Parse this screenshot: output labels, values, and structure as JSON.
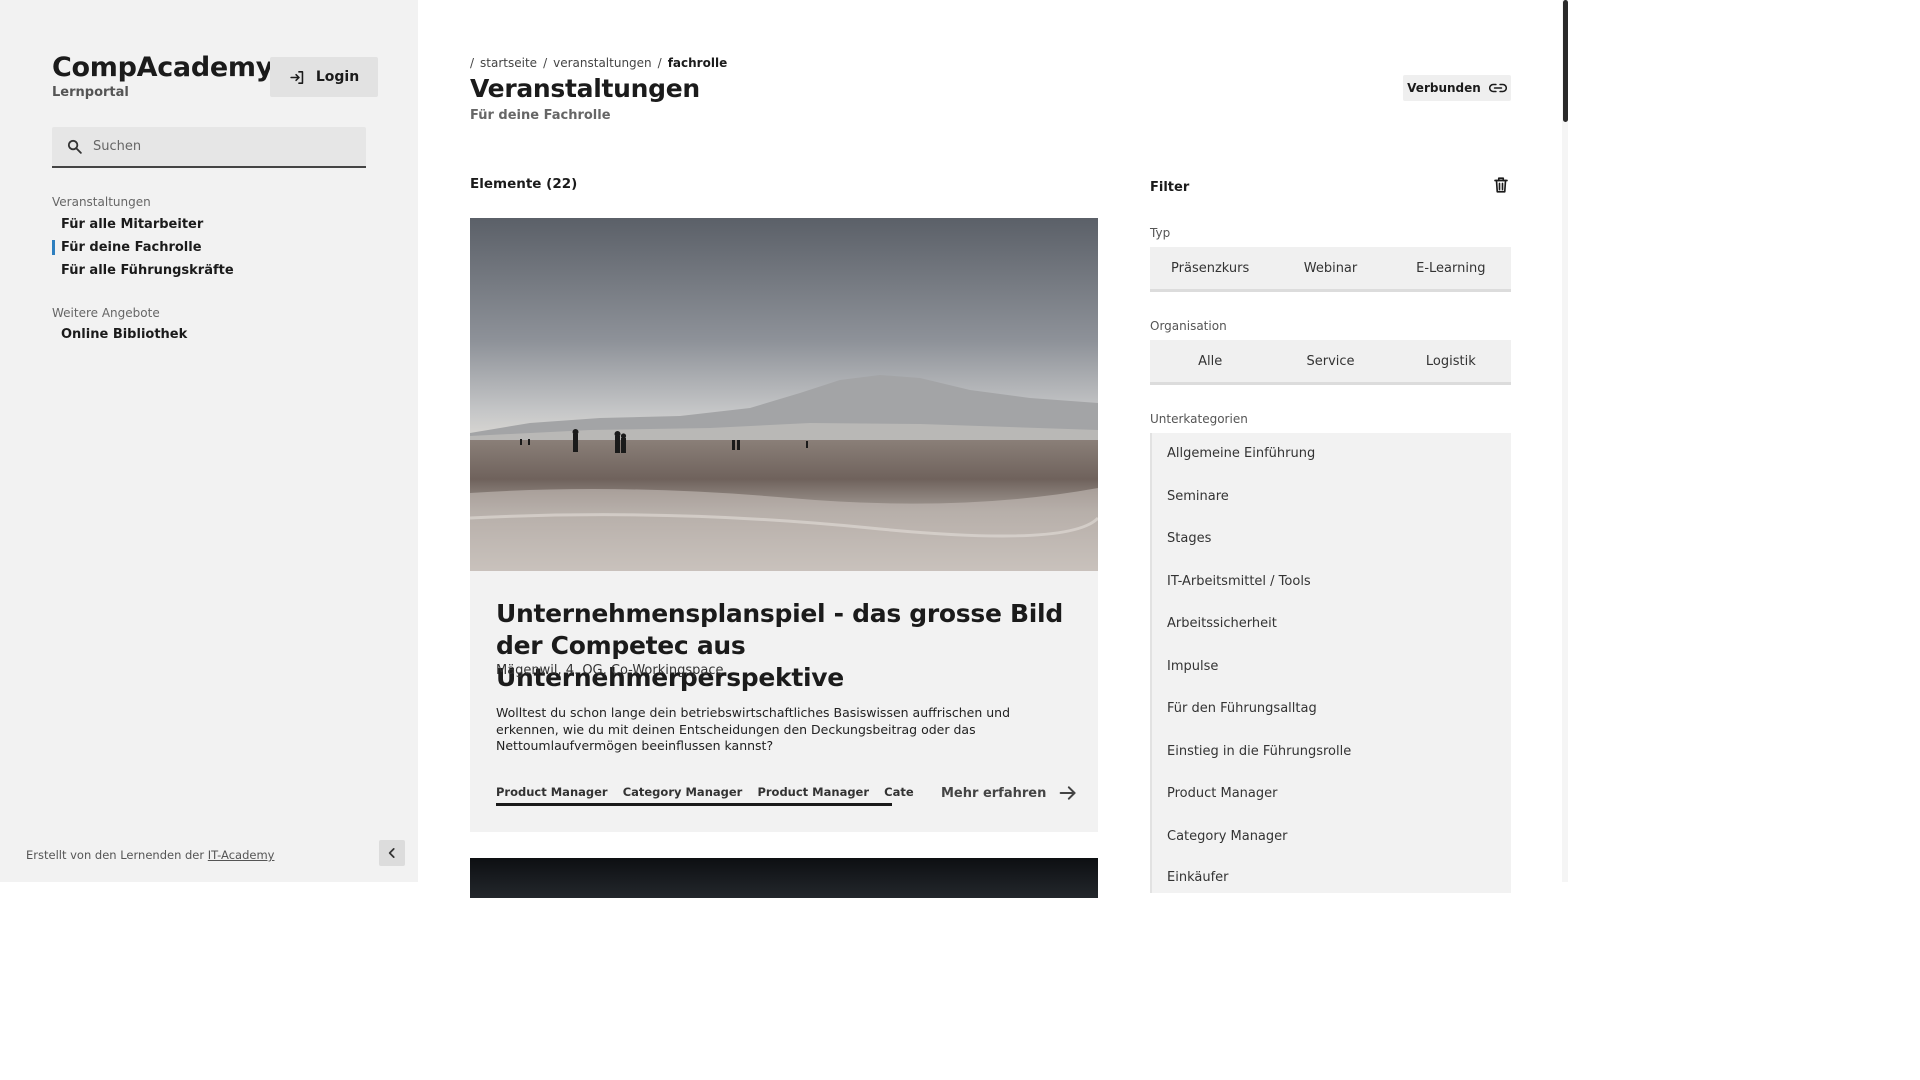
{
  "brand": {
    "title": "CompAcademy",
    "subtitle": "Lernportal"
  },
  "login": {
    "label": "Login"
  },
  "search": {
    "placeholder": "Suchen"
  },
  "nav": {
    "groups": [
      {
        "label": "Veranstaltungen",
        "items": [
          {
            "label": "Für alle Mitarbeiter"
          },
          {
            "label": "Für deine Fachrolle",
            "active": true
          },
          {
            "label": "Für alle Führungskräfte"
          }
        ]
      },
      {
        "label": "Weitere Angebote",
        "items": [
          {
            "label": "Online Bibliothek"
          }
        ]
      }
    ]
  },
  "footer": {
    "prefix": "Erstellt von den Lernenden der",
    "link": "IT-Academy"
  },
  "breadcrumb": {
    "items": [
      "startseite",
      "veranstaltungen",
      "fachrolle"
    ]
  },
  "page": {
    "title": "Veranstaltungen",
    "subtitle": "Für deine Fachrolle"
  },
  "connect": {
    "label": "Verbunden"
  },
  "elements": {
    "label": "Elemente (22)"
  },
  "card": {
    "title": "Unternehmensplanspiel - das grosse Bild der Competec aus Unternehmerperspektive",
    "location": "Mägenwil, 4. OG, Co-Workingspace",
    "description": "Wolltest du schon lange dein betriebswirtschaftliches Basiswissen auffrischen und erkennen, wie du mit deinen Entscheidungen den Deckungsbeitrag oder das Nettoumlaufvermögen beeinflussen kannst?",
    "tags": [
      "Product Manager",
      "Category Manager",
      "Product Manager",
      "Category Manager"
    ],
    "more": "Mehr erfahren"
  },
  "filter": {
    "title": "Filter",
    "typ": {
      "label": "Typ",
      "options": [
        "Präsenzkurs",
        "Webinar",
        "E-Learning"
      ]
    },
    "organisation": {
      "label": "Organisation",
      "options": [
        "Alle",
        "Service",
        "Logistik"
      ]
    },
    "unterkategorien": {
      "label": "Unterkategorien",
      "items": [
        "Allgemeine Einführung",
        "Seminare",
        "Stages",
        "IT-Arbeitsmittel / Tools",
        "Arbeitssicherheit",
        "Impulse",
        "Für den Führungsalltag",
        "Einstieg in die Führungsrolle",
        "Product Manager",
        "Category Manager",
        "Einkäufer"
      ]
    }
  },
  "colors": {
    "accent": "#2e7fbf",
    "sidebar_bg": "#f2f2f2",
    "card_bg": "#f2f2f2"
  }
}
